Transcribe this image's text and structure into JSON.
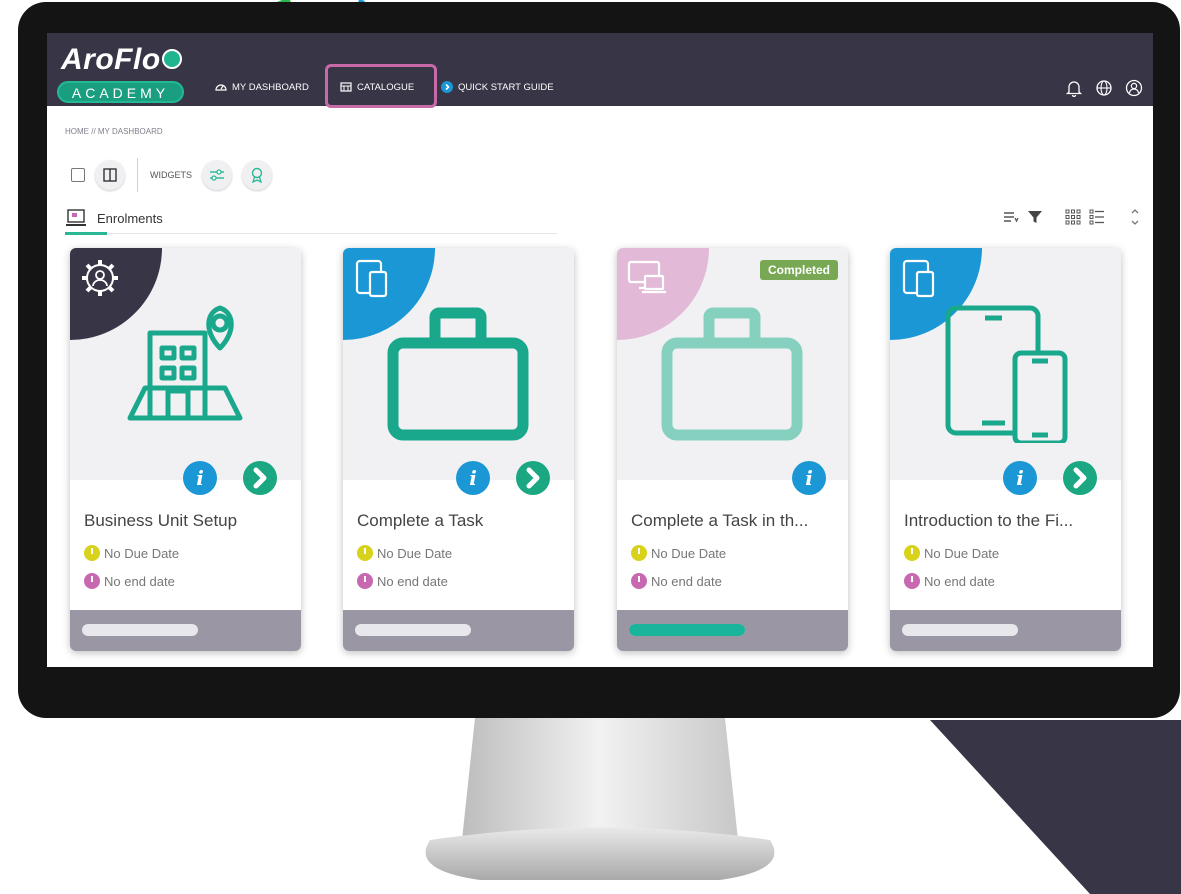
{
  "brand": {
    "name": "AroFlo",
    "academy": "ACADEMY"
  },
  "nav": {
    "items": [
      {
        "label": "MY DASHBOARD",
        "icon": "gauge-icon"
      },
      {
        "label": "CATALOGUE",
        "icon": "catalogue-icon"
      },
      {
        "label": "QUICK START GUIDE",
        "icon": "chevron-right-circle-icon"
      }
    ],
    "right_icons": [
      "bell-icon",
      "globe-icon",
      "user-icon"
    ]
  },
  "breadcrumb": "HOME // MY DASHBOARD",
  "toolbar": {
    "widgets_label": "WIDGETS"
  },
  "section": {
    "tab_label": "Enrolments"
  },
  "cards": [
    {
      "title": "Business Unit Setup",
      "due": "No Due Date",
      "end": "No end date",
      "corner_color": "#373546",
      "corner_icon": "gear-user-icon",
      "hero_icon": "building-location-icon",
      "hero_color": "#1aa88c",
      "badge": "",
      "progress": 0,
      "has_go": true
    },
    {
      "title": "Complete a Task",
      "due": "No Due Date",
      "end": "No end date",
      "corner_color": "#1a97d4",
      "corner_icon": "mobile-tablet-icon",
      "hero_icon": "briefcase-icon",
      "hero_color": "#1aa88c",
      "badge": "",
      "progress": 0,
      "has_go": true
    },
    {
      "title": "Complete a Task in th...",
      "due": "No Due Date",
      "end": "No end date",
      "corner_color": "#e2b9d7",
      "corner_icon": "desktop-laptop-icon",
      "hero_icon": "briefcase-icon",
      "hero_color": "#86d0c0",
      "badge": "Completed",
      "progress": 1,
      "has_go": false
    },
    {
      "title": "Introduction to the Fi...",
      "due": "No Due Date",
      "end": "No end date",
      "corner_color": "#1a97d4",
      "corner_icon": "mobile-tablet-icon",
      "hero_icon": "tablet-phone-icon",
      "hero_color": "#1aa88c",
      "badge": "",
      "progress": 0,
      "has_go": true
    }
  ],
  "colors": {
    "navbar": "#373546",
    "accent": "#1aa781",
    "info": "#1a97d4",
    "highlight": "#c86aa8",
    "due_icon": "#d8d21a",
    "end_icon": "#c768b0"
  }
}
